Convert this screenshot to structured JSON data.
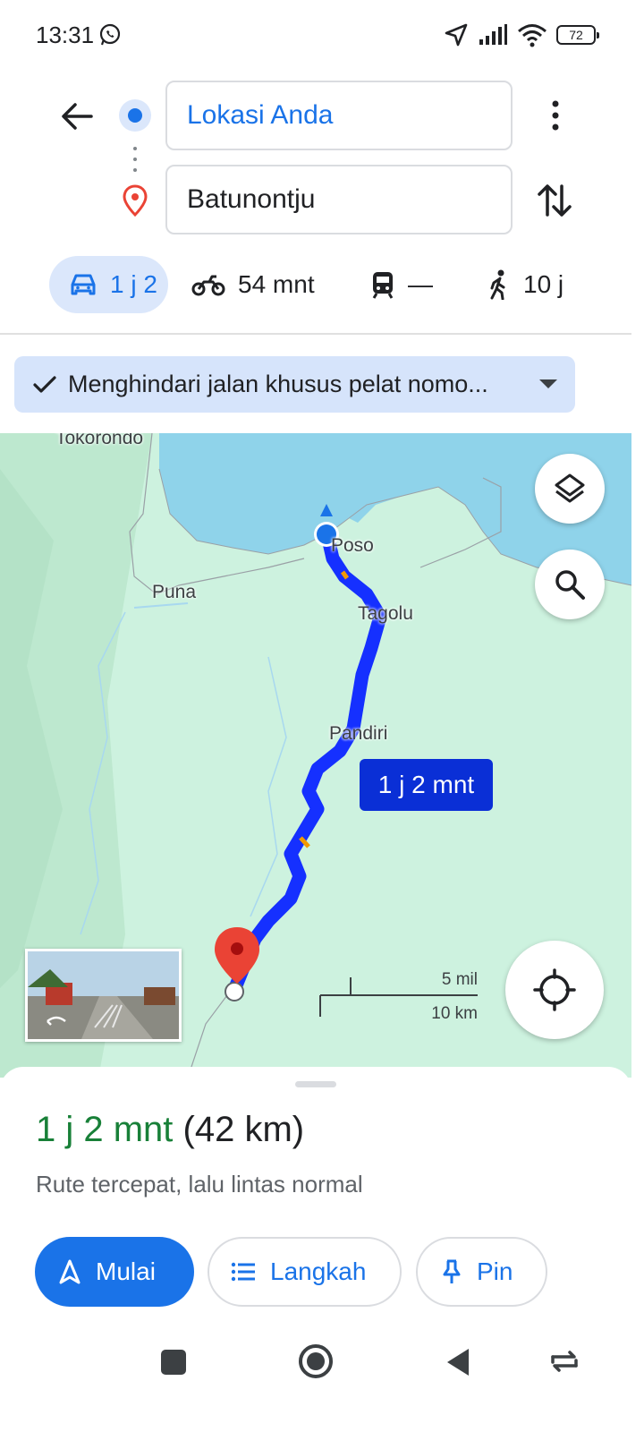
{
  "status_bar": {
    "time": "13:31",
    "battery": "72",
    "icons": [
      "whatsapp-icon",
      "location-arrow-icon",
      "signal-icon",
      "wifi-icon",
      "battery-icon"
    ]
  },
  "directions": {
    "origin_value": "Lokasi Anda",
    "destination_value": "Batunontju"
  },
  "modes": [
    {
      "label": "1 j 2",
      "icon": "car-icon",
      "active": true
    },
    {
      "label": "54 mnt",
      "icon": "motorcycle-icon",
      "active": false
    },
    {
      "label": "—",
      "icon": "transit-icon",
      "active": false
    },
    {
      "label": "10 j",
      "icon": "walk-icon",
      "active": false
    }
  ],
  "filter_chip": {
    "label": "Menghindari jalan khusus pelat nomo..."
  },
  "map": {
    "labels": {
      "tokorondo": "Tokorondo",
      "poso": "Poso",
      "puna": "Puna",
      "tagolu": "Tagolu",
      "pandiri": "Pandiri"
    },
    "route_time": "1 j 2 mnt",
    "scale_top": "5 mil",
    "scale_bottom": "10 km",
    "colors": {
      "water": "#8fd3ea",
      "land": "#cdf2df",
      "route": "#1530ff",
      "callout": "#0a2fd6",
      "destination_pin": "#ea4335"
    }
  },
  "sheet": {
    "duration": "1 j 2 mnt",
    "distance": "(42 km)",
    "description": "Rute tercepat, lalu lintas normal",
    "buttons": {
      "start": "Mulai",
      "steps": "Langkah",
      "pin": "Pin"
    }
  },
  "colors": {
    "accent": "#1a73e8",
    "duration_green": "#188038"
  }
}
